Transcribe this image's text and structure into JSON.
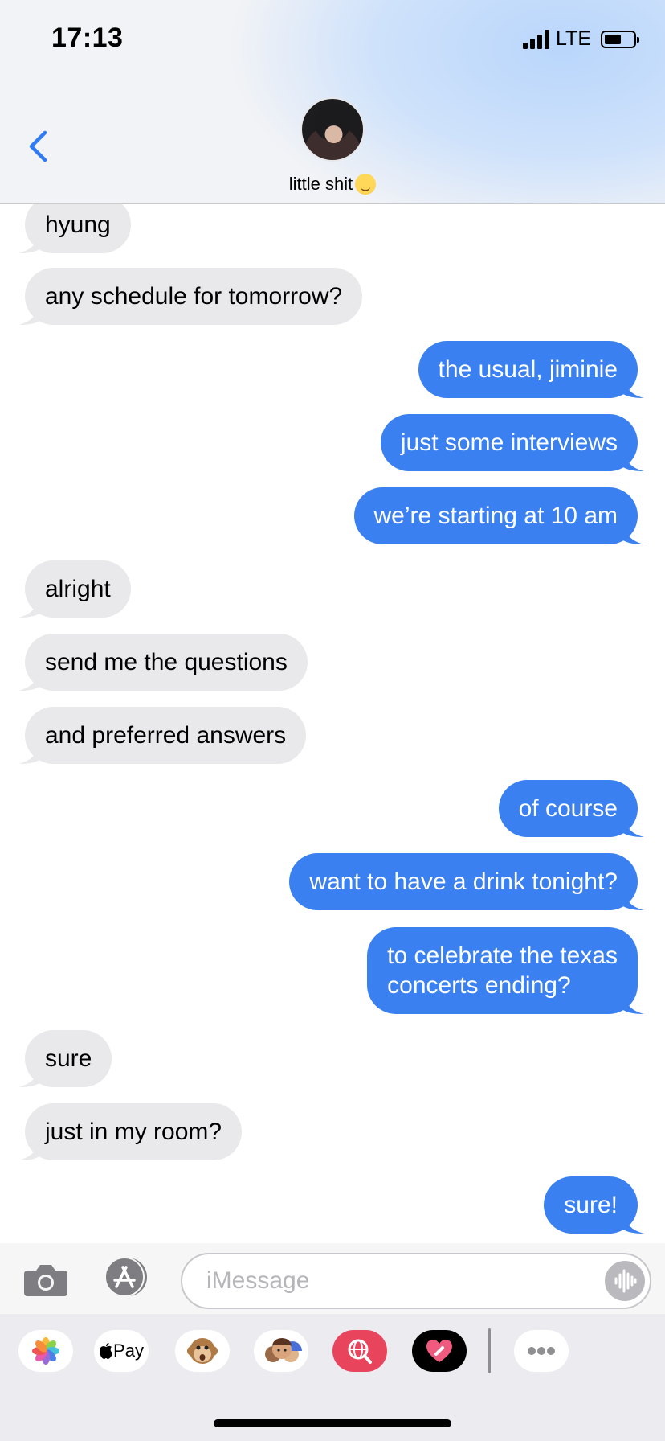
{
  "status_bar": {
    "time": "17:13",
    "network": "LTE"
  },
  "header": {
    "contact_name": "little shit"
  },
  "messages": [
    {
      "dir": "in",
      "text": "hyung"
    },
    {
      "dir": "in",
      "text": "any schedule for tomorrow?"
    },
    {
      "dir": "out",
      "text": "the usual, jiminie"
    },
    {
      "dir": "out",
      "text": "just some interviews"
    },
    {
      "dir": "out",
      "text": "we’re starting at 10 am"
    },
    {
      "dir": "in",
      "text": "alright"
    },
    {
      "dir": "in",
      "text": "send me the questions"
    },
    {
      "dir": "in",
      "text": "and preferred answers"
    },
    {
      "dir": "out",
      "text": "of course"
    },
    {
      "dir": "out",
      "text": "want to have a drink tonight?"
    },
    {
      "dir": "out",
      "text": "to celebrate the texas",
      "text2": "concerts ending?"
    },
    {
      "dir": "in",
      "text": "sure"
    },
    {
      "dir": "in",
      "text": "just in my room?"
    },
    {
      "dir": "out",
      "text": "sure!"
    }
  ],
  "composer": {
    "placeholder": "iMessage"
  },
  "apps": [
    {
      "name": "photos-app",
      "label": ""
    },
    {
      "name": "apple-pay-app",
      "label": "Pay"
    },
    {
      "name": "animoji-app",
      "label": ""
    },
    {
      "name": "memoji-stickers-app",
      "label": ""
    },
    {
      "name": "search-images-app",
      "label": ""
    },
    {
      "name": "digital-touch-app",
      "label": ""
    },
    {
      "name": "more-apps",
      "label": ""
    }
  ],
  "colors": {
    "outgoing": "#3a80f0",
    "incoming": "#e9e9eb",
    "link": "#2f7bf5"
  }
}
